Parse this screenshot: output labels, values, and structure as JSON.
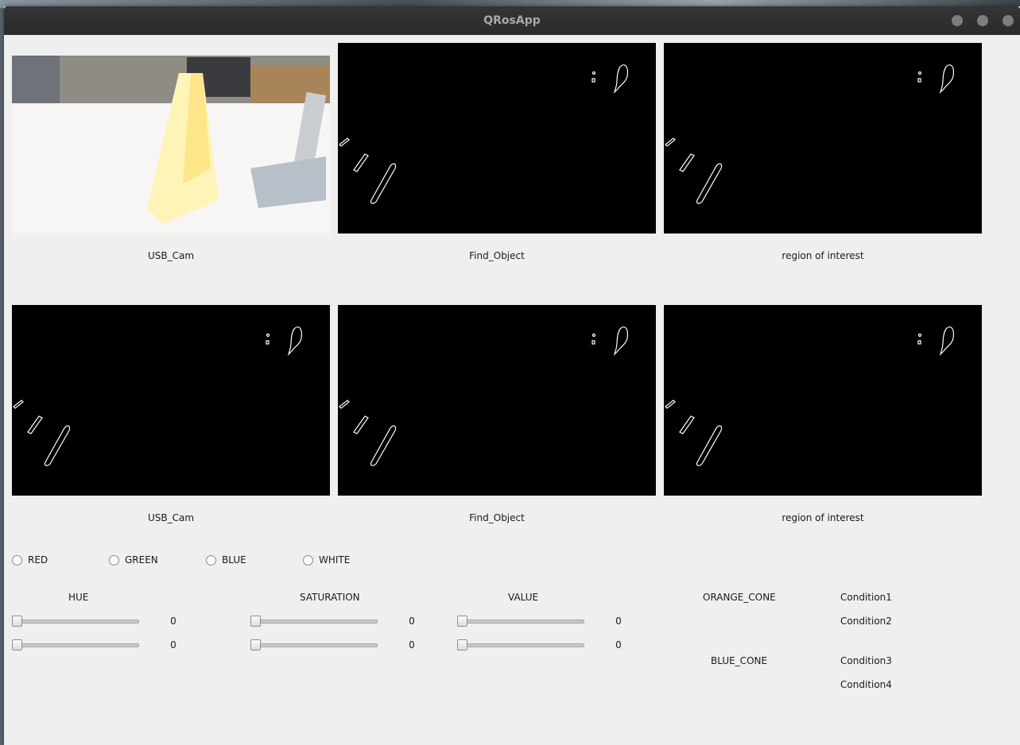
{
  "window": {
    "title": "QRosApp"
  },
  "panels_row1": [
    {
      "caption": "USB_Cam",
      "kind": "photo"
    },
    {
      "caption": "Find_Object",
      "kind": "edges"
    },
    {
      "caption": "region of interest",
      "kind": "edges"
    }
  ],
  "panels_row2": [
    {
      "caption": "USB_Cam",
      "kind": "edges"
    },
    {
      "caption": "Find_Object",
      "kind": "edges"
    },
    {
      "caption": "region of interest",
      "kind": "edges"
    }
  ],
  "colors": {
    "options": [
      "RED",
      "GREEN",
      "BLUE",
      "WHITE"
    ]
  },
  "hsv": {
    "hue": {
      "label": "HUE",
      "min": 0,
      "max": 0
    },
    "saturation": {
      "label": "SATURATION",
      "min": 0,
      "max": 0
    },
    "value": {
      "label": "VALUE",
      "min": 0,
      "max": 0
    }
  },
  "cones": {
    "orange": {
      "label": "ORANGE_CONE",
      "conditions": [
        "Condition1",
        "Condition2"
      ]
    },
    "blue": {
      "label": "BLUE_CONE",
      "conditions": [
        "Condition3",
        "Condition4"
      ]
    }
  },
  "accent": {
    "titlebar": "#2b2b2d",
    "window_bg": "#efefef",
    "panel_bg": "#000000"
  }
}
